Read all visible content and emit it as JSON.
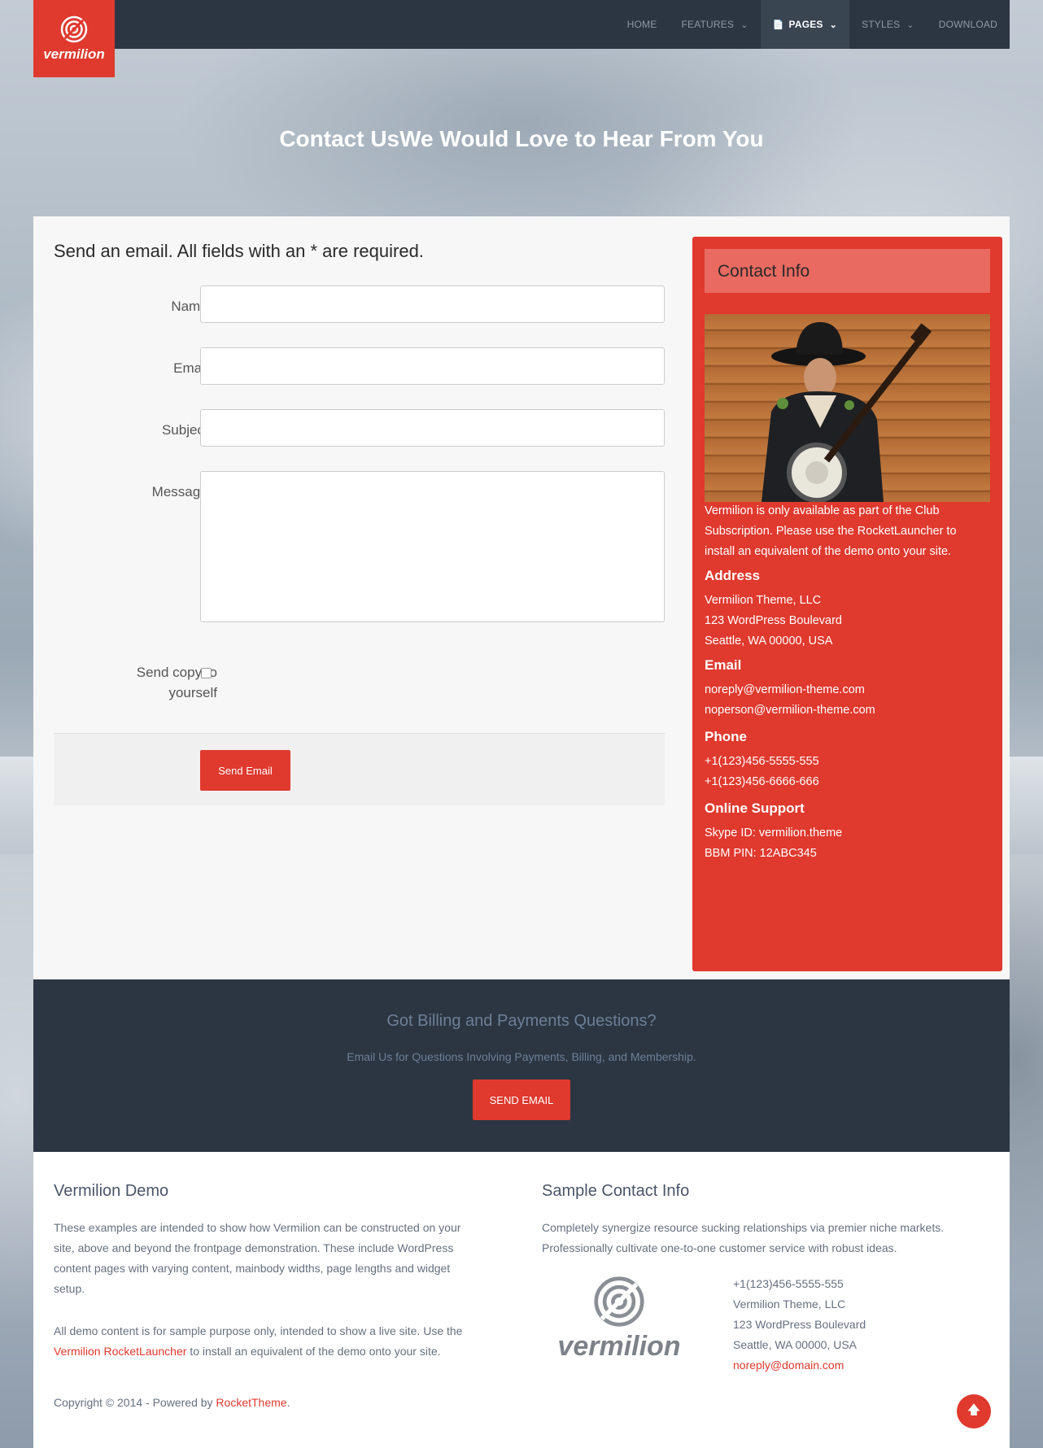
{
  "brand": {
    "name": "vermilion"
  },
  "nav": {
    "items": [
      {
        "label": "HOME"
      },
      {
        "label": "FEATURES"
      },
      {
        "label": "PAGES"
      },
      {
        "label": "STYLES"
      },
      {
        "label": "DOWNLOAD"
      }
    ]
  },
  "hero": {
    "title": "Contact UsWe Would Love to Hear From You"
  },
  "form": {
    "heading": "Send an email. All fields with an * are required.",
    "name_label": "Name *",
    "email_label": "Email *",
    "subject_label": "Subject *",
    "message_label": "Message *",
    "copy_label_1": "Send copy to",
    "copy_label_2": "yourself",
    "send_label": "Send Email"
  },
  "contact_info": {
    "title": "Contact Info",
    "intro_1": "Vermilion is only available as part of the Club",
    "intro_2": "Subscription. Please use the RocketLauncher to",
    "intro_3": "install an equivalent of the demo onto your site.",
    "address_h": "Address",
    "address_1": "Vermilion Theme, LLC",
    "address_2": "123 WordPress Boulevard",
    "address_3": "Seattle, WA 00000, USA",
    "email_h": "Email",
    "email_1": "noreply@vermilion-theme.com",
    "email_2": "noperson@vermilion-theme.com",
    "phone_h": "Phone",
    "phone_1": "+1(123)456-5555-555",
    "phone_2": "+1(123)456-6666-666",
    "support_h": "Online Support",
    "support_1": "Skype ID: vermilion.theme",
    "support_2": "BBM PIN: 12ABC345"
  },
  "billing": {
    "title": "Got Billing and Payments Questions?",
    "subtitle": "Email Us for Questions Involving Payments, Billing, and Membership.",
    "button": "SEND EMAIL"
  },
  "footer": {
    "demo_title": "Vermilion Demo",
    "demo_p1_1": "These examples are intended to show how Vermilion can be constructed on your",
    "demo_p1_2": "site, above and beyond the frontpage demonstration. These include WordPress",
    "demo_p1_3": "content pages with varying content, mainbody widths, page lengths and widget",
    "demo_p1_4": "setup.",
    "demo_p2_1": "All demo content is for sample purpose only, intended to show a live site. Use the",
    "demo_p2_link": "Vermilion RocketLauncher",
    "demo_p2_2": " to install an equivalent of the demo onto your site.",
    "sample_title": "Sample Contact Info",
    "sample_p1": "Completely synergize resource sucking relationships via premier niche markets.",
    "sample_p2": "Professionally cultivate one-to-one customer service with robust ideas.",
    "sample_logo": "vermilion",
    "sample_phone": "+1(123)456-5555-555",
    "sample_company": "Vermilion Theme, LLC",
    "sample_street": "123 WordPress Boulevard",
    "sample_city": "Seattle, WA 00000, USA",
    "sample_email": "noreply@domain.com",
    "copyright": "Copyright © 2014 - Powered by ",
    "copyright_link": "RocketTheme",
    "copyright_end": "."
  },
  "colors": {
    "accent": "#e0392e",
    "dark": "#2c3642"
  }
}
